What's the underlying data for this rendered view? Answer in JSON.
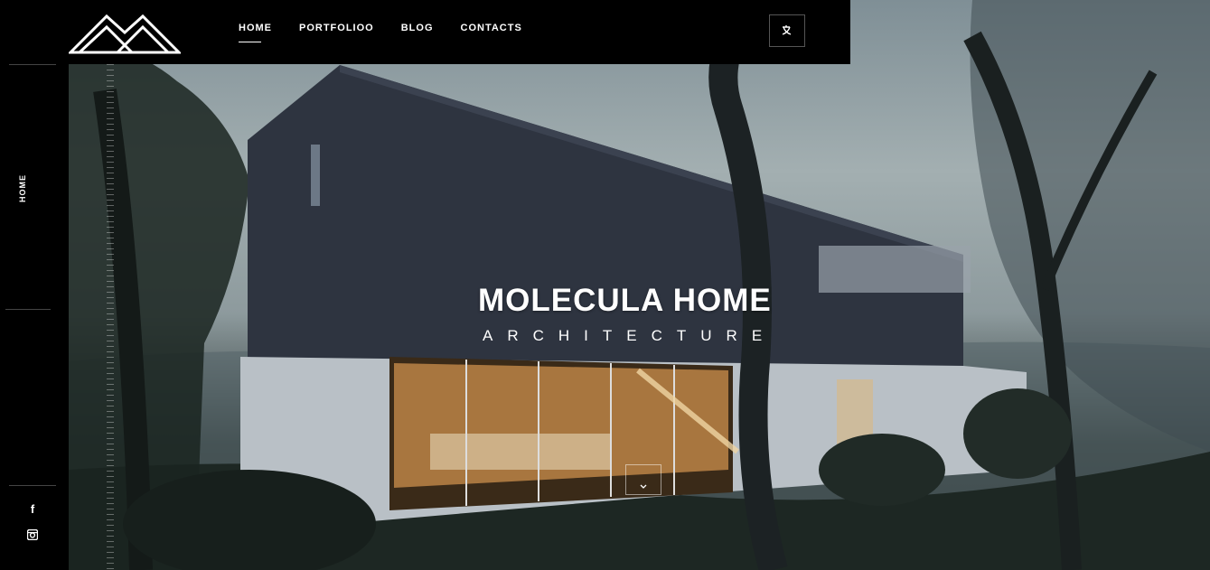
{
  "nav": {
    "items": [
      {
        "label": "HOME",
        "active": true
      },
      {
        "label": "PORTFOLIOO"
      },
      {
        "label": "BLOG"
      },
      {
        "label": "CONTACTS"
      }
    ],
    "lang_icon": "translate-icon"
  },
  "sidebar": {
    "current_section": "HOME",
    "social": [
      {
        "icon": "facebook-icon",
        "glyph": "f"
      },
      {
        "icon": "instagram-icon"
      }
    ]
  },
  "hero": {
    "title": "MOLECULA HOME",
    "subtitle": "ARCHITECTURE",
    "scroll_icon": "chevron-down-icon"
  },
  "colors": {
    "background": "#000000",
    "text": "#ffffff"
  }
}
